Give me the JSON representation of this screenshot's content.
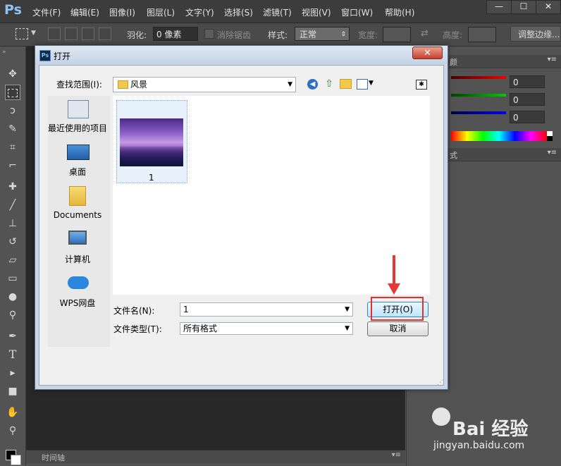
{
  "app": {
    "logo": "Ps",
    "menu": [
      "文件(F)",
      "编辑(E)",
      "图像(I)",
      "图层(L)",
      "文字(Y)",
      "选择(S)",
      "滤镜(T)",
      "视图(V)",
      "窗口(W)",
      "帮助(H)"
    ],
    "window_controls": [
      "—",
      "☐",
      "✕"
    ]
  },
  "options": {
    "feather_label": "羽化:",
    "feather_value": "0 像素",
    "antialias_label": "消除锯齿",
    "style_label": "样式:",
    "style_value": "正常",
    "width_label": "宽度:",
    "height_label": "高度:",
    "refine_button": "调整边缘..."
  },
  "right_panel": {
    "color_values": [
      "0",
      "0",
      "0"
    ],
    "tab_fragment_1": "颜",
    "tab_fragment_2": "式"
  },
  "timeline": {
    "label": "时间轴"
  },
  "dialog": {
    "title": "打开",
    "ps_badge": "Ps",
    "close": "✕",
    "lookin_label": "查找范围(I):",
    "lookin_value": "风景",
    "places": [
      "最近使用的项目",
      "桌面",
      "Documents",
      "计算机",
      "WPS网盘"
    ],
    "file": {
      "name": "1"
    },
    "filename_label": "文件名(N):",
    "filename_value": "1",
    "filetype_label": "文件类型(T):",
    "filetype_value": "所有格式",
    "open_button": "打开(O)",
    "cancel_button": "取消"
  },
  "colors": {
    "highlight": "#e03030",
    "arrow": "#e53935"
  },
  "watermark": {
    "brand": "Bai  经验",
    "url": "jingyan.baidu.com"
  }
}
